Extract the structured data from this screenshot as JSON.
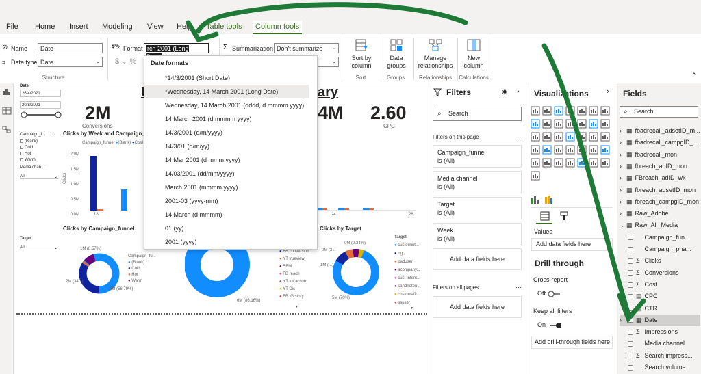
{
  "menu": {
    "tabs": [
      "File",
      "Home",
      "Insert",
      "Modeling",
      "View",
      "Help",
      "Table tools",
      "Column tools"
    ]
  },
  "ribbon": {
    "name_label": "Name",
    "name_value": "Date",
    "datatype_label": "Data type",
    "datatype_value": "Date",
    "structure_label": "Structure",
    "format_label": "Format",
    "format_value": "rch 2001 (Long Date)",
    "summarization_label": "Summarization",
    "summarization_value": "Don't summarize",
    "currency_symbols": "$ ⌄ %",
    "sort_by_column": "Sort by column",
    "sort_group": "Sort",
    "data_groups": "Data groups",
    "groups_group": "Groups",
    "manage_relationships": "Manage relationships",
    "relationships_group": "Relationships",
    "new_column": "New column",
    "calculations_group": "Calculations"
  },
  "dropdown": {
    "header": "Date formats",
    "items": [
      "*14/3/2001 (Short Date)",
      "*Wednesday, 14 March 2001 (Long Date)",
      "Wednesday, 14 March 2001 (dddd, d mmmm yyyy)",
      "14 March 2001 (d mmmm yyyy)",
      "14/3/2001 (d/m/yyyy)",
      "14/3/01 (d/m/yy)",
      "14 Mar 2001 (d mmm yyyy)",
      "14/03/2001 (dd/mm/yyyy)",
      "March 2001 (mmmm yyyy)",
      "2001-03 (yyyy-mm)",
      "14 March (d mmmm)",
      "01 (yy)",
      "2001 (yyyy)"
    ],
    "selected_index": 1
  },
  "canvas": {
    "date_slicer": {
      "title": "Date",
      "start": "26/4/2021",
      "end": "20/8/2021"
    },
    "title_fragment": "ary",
    "kpi_conversions": {
      "value": "2M",
      "label": "Conversions"
    },
    "kpi_4m": {
      "value": "4M"
    },
    "kpi_cpc": {
      "value": "2.60",
      "label": "CPC"
    },
    "campaign_slicer": {
      "title": "Campaign_f...",
      "items": [
        "(Blank)",
        "Cold",
        "Hot",
        "Warm"
      ]
    },
    "media_slicer": {
      "title": "Media chan...",
      "value": "All"
    },
    "target_slicer": {
      "title": "Target",
      "value": "All"
    },
    "chart_week_title": "Clicks by Week and Campaign_funnel",
    "chart_week_legend": [
      "Campaign_funnel",
      "(Blank)",
      "Cold",
      "Ho"
    ],
    "chart_week_yticks": [
      "2.0M",
      "1.5M",
      "1.0M",
      "0.5M",
      "0.0M"
    ],
    "chart_week_ylabel": "Clicks",
    "chart_week_xticks": [
      "18",
      "24",
      "26"
    ],
    "chart_funnel_title": "Clicks by Campaign_funnel",
    "donut1_labels": [
      "1M (8.57%)",
      "2M (34...)",
      "4M (56.79%)"
    ],
    "donut1_legend_title": "Campaign_fu...",
    "donut1_legend": [
      "(Blank)",
      "Cold",
      "Hot",
      "Warm"
    ],
    "donut2_label": "6M (86.16%)",
    "donut2_legend": [
      "FB conversion",
      "YT trueview",
      "SEM",
      "FB reach",
      "YT for action",
      "YT Dis",
      "FB IG story"
    ],
    "chart_target_title": "Clicks by Target",
    "donut3_labels": [
      "0M (0.34%)",
      "0M (2...",
      "1M (...)",
      "5M (70%)"
    ],
    "target_legend_title": "Target",
    "target_legend": [
      "customint...",
      "rtg",
      "paduser",
      "acompany...",
      "cust-intent...",
      "sandnoteu...",
      "customaffi...",
      "ssuser"
    ]
  },
  "filters": {
    "title": "Filters",
    "search": "Search",
    "on_page": "Filters on this page",
    "cards": [
      {
        "name": "Campaign_funnel",
        "value": "is (All)"
      },
      {
        "name": "Media channel",
        "value": "is (All)"
      },
      {
        "name": "Target",
        "value": "is (All)"
      },
      {
        "name": "Week",
        "value": "is (All)"
      }
    ],
    "add_fields": "Add data fields here",
    "on_all_pages": "Filters on all pages",
    "add_fields_all": "Add data fields here"
  },
  "visualizations": {
    "title": "Visualizations",
    "values_label": "Values",
    "add_fields": "Add data fields here",
    "drill_title": "Drill through",
    "cross_report": "Cross-report",
    "cross_state": "Off",
    "keep_filters": "Keep all filters",
    "keep_state": "On",
    "add_drill": "Add drill-through fields here"
  },
  "fields": {
    "title": "Fields",
    "search": "Search",
    "tables": [
      "fbadrecall_adsetID_m...",
      "fbadrecall_campgID_...",
      "fbadrecall_mon",
      "fbreach_adID_mon",
      "FBreach_adID_wk",
      "fbreach_adsetID_mon",
      "fbreach_campgID_mon",
      "Raw_Adobe",
      "Raw_All_Media"
    ],
    "columns": [
      {
        "name": "Campaign_fun...",
        "sigma": false
      },
      {
        "name": "Campaign_pha...",
        "sigma": false
      },
      {
        "name": "Clicks",
        "sigma": true
      },
      {
        "name": "Conversions",
        "sigma": true
      },
      {
        "name": "Cost",
        "sigma": true
      },
      {
        "name": "CPC",
        "sigma": false,
        "calc": true
      },
      {
        "name": "CTR",
        "sigma": false,
        "calc": true
      },
      {
        "name": "Date",
        "sigma": false,
        "date": true
      },
      {
        "name": "Impressions",
        "sigma": true
      },
      {
        "name": "Media channel",
        "sigma": false
      },
      {
        "name": "Search impress...",
        "sigma": true
      },
      {
        "name": "Search volume",
        "sigma": false
      }
    ]
  },
  "colors": {
    "accent": "#3a6f1f",
    "annotation": "#1f7a37",
    "blank": "#118dff",
    "cold": "#12239e",
    "hot": "#e66c37",
    "warm": "#6b007b"
  }
}
